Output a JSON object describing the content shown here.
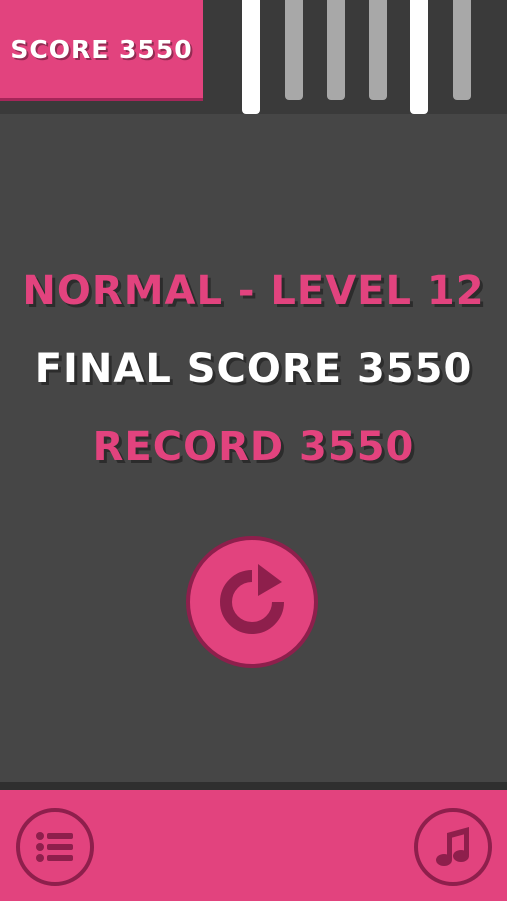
{
  "header": {
    "score_label": "SCORE 3550",
    "bars": [
      "white",
      "grey",
      "grey",
      "grey",
      "white",
      "grey"
    ]
  },
  "result": {
    "mode_level": "NORMAL - LEVEL 12",
    "final_score": "FINAL SCORE 3550",
    "record": "RECORD 3550"
  },
  "controls": {
    "restart_icon": "restart-icon",
    "menu_icon": "list-icon",
    "music_icon": "music-note-icon"
  },
  "colors": {
    "accent": "#e2437e",
    "accent_dark": "#8e1f4c",
    "background": "#464646"
  }
}
